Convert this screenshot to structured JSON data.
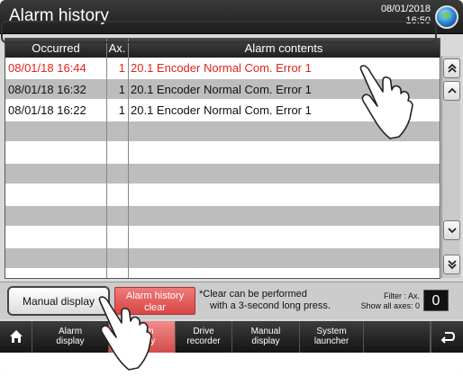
{
  "window": {
    "title": "Alarm history",
    "date": "08/01/2018",
    "time": "16:50",
    "globe_icon": "globe-icon"
  },
  "table": {
    "headers": {
      "occurred": "Occurred",
      "axis": "Ax.",
      "contents": "Alarm contents"
    },
    "rows": [
      {
        "occurred": "08/01/18  16:44",
        "axis": "1",
        "contents": "20.1  Encoder Normal Com. Error 1",
        "selected": true
      },
      {
        "occurred": "08/01/18  16:32",
        "axis": "1",
        "contents": "20.1  Encoder Normal Com. Error 1",
        "selected": false
      },
      {
        "occurred": "08/01/18  16:22",
        "axis": "1",
        "contents": "20.1  Encoder Normal Com. Error 1",
        "selected": false
      }
    ],
    "empty_rows": 8
  },
  "scrollbar": {
    "top_icon": "double-chevron-up-icon",
    "up_icon": "chevron-up-icon",
    "down_icon": "chevron-down-icon",
    "bottom_icon": "double-chevron-down-icon"
  },
  "actions": {
    "manual_display": "Manual display",
    "alarm_history_clear_line1": "Alarm history",
    "alarm_history_clear_line2": "clear",
    "note_line1": "*Clear can be performed",
    "note_line2": "with a 3-second long press.",
    "filter_line1": "Filter : Ax.",
    "filter_line2": "Show all axes: 0",
    "filter_value": "0"
  },
  "nav": {
    "home_icon": "home-icon",
    "items": [
      {
        "line1": "Alarm",
        "line2": "display"
      },
      {
        "line1": "Alarm",
        "line2": "history",
        "active": true
      },
      {
        "line1": "Drive",
        "line2": "recorder"
      },
      {
        "line1": "Manual",
        "line2": "display"
      },
      {
        "line1": "System",
        "line2": "launcher"
      }
    ],
    "back_icon": "return-arrow-icon"
  },
  "colors": {
    "alarm_red": "#e2231a",
    "clear_button": "#d84545",
    "header_dark": "#1f1f1f"
  }
}
